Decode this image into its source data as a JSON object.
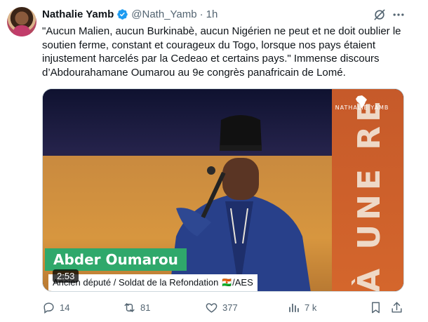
{
  "author": {
    "name": "Nathalie Yamb",
    "handle": "@Nath_Yamb",
    "separator": "·",
    "time": "1h"
  },
  "tweet_text": "\"Aucun Malien, aucun Burkinabè, aucun Nigérien ne peut et ne doit oublier le soutien ferme, constant et courageux du Togo, lorsque nos pays étaient injustement harcelés par la Cedeao et certains pays.\" Immense discours d’Abdourahamane Oumarou au 9e congrès panafricain de Lomé.",
  "media": {
    "watermark": "NATHALIE YAMB",
    "banner_text": "À UNE RES",
    "lower_third_name": "Abder Oumarou",
    "lower_third_title": "Ancien député / Soldat de la Refondation 🇳🇪/AES",
    "duration": "2:53"
  },
  "actions": {
    "replies": "14",
    "reposts": "81",
    "likes": "377",
    "views": "7 k"
  },
  "icons": {
    "verified": "verified-badge-icon",
    "grok": "grok-icon",
    "more": "more-icon",
    "reply": "reply-icon",
    "repost": "repost-icon",
    "like": "heart-icon",
    "views": "analytics-icon",
    "bookmark": "bookmark-icon",
    "share": "share-icon"
  },
  "colors": {
    "accent": "#1d9bf0",
    "muted": "#536471",
    "lower_third_green": "#2fa86b"
  }
}
